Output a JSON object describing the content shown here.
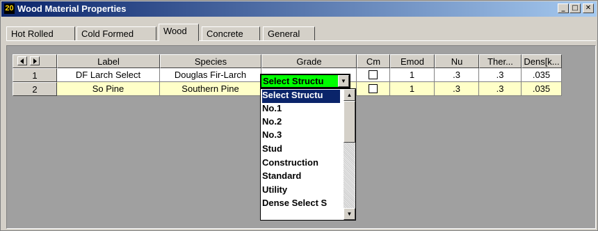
{
  "window": {
    "icon": "20",
    "title": "Wood Material Properties"
  },
  "tabs": [
    {
      "label": "Hot Rolled"
    },
    {
      "label": "Cold Formed"
    },
    {
      "label": "Wood"
    },
    {
      "label": "Concrete"
    },
    {
      "label": "General"
    }
  ],
  "active_tab": "Wood",
  "columns": [
    "Label",
    "Species",
    "Grade",
    "Cm",
    "Emod",
    "Nu",
    "Ther...",
    "Dens[k..."
  ],
  "rows": [
    {
      "num": "1",
      "label": "DF Larch Select",
      "species": "Douglas Fir-Larch",
      "grade": "Select Structural",
      "emod": "1",
      "nu": ".3",
      "ther": ".3",
      "dens": ".035"
    },
    {
      "num": "2",
      "label": "So Pine",
      "species": "Southern Pine",
      "grade": "",
      "emod": "1",
      "nu": ".3",
      "ther": ".3",
      "dens": ".035"
    }
  ],
  "combo_value": "Select Structu",
  "dropdown_options": [
    "Select Structu",
    "No.1",
    "No.2",
    "No.3",
    "Stud",
    "Construction",
    "Standard",
    "Utility",
    "Dense Select S"
  ],
  "icons": [
    "minimize-icon",
    "maximize-icon",
    "close-icon",
    "nav-left-icon",
    "nav-right-icon",
    "dropdown-arrow-icon",
    "scroll-up-icon",
    "scroll-down-icon"
  ]
}
